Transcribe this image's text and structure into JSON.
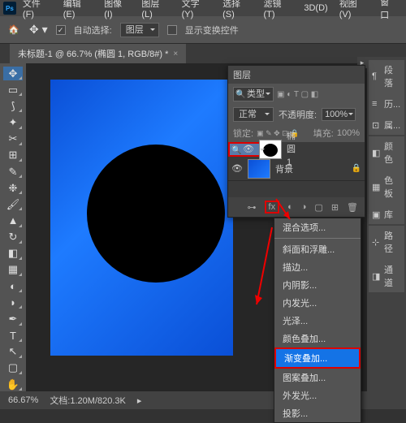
{
  "menu": {
    "items": [
      "文件(F)",
      "编辑(E)",
      "图像(I)",
      "图层(L)",
      "文字(Y)",
      "选择(S)",
      "滤镜(T)",
      "3D(D)",
      "视图(V)",
      "窗口"
    ]
  },
  "optbar": {
    "auto_select": "自动选择:",
    "layer": "图层",
    "show_transform": "显示变换控件"
  },
  "tab": {
    "title": "未标题-1 @ 66.7% (椭圆 1, RGB/8#) *"
  },
  "right": {
    "duanluo": "段落",
    "lishi": "历...",
    "shuxing": "属...",
    "yanse": "颜色",
    "secai": "色板",
    "kuang": "库",
    "lujing": "路径",
    "tongdao": "通道"
  },
  "layers": {
    "title": "图层",
    "type": "类型",
    "blend": "正常",
    "opacity_label": "不透明度:",
    "opacity": "100%",
    "lock_label": "锁定:",
    "fill_label": "填充:",
    "fill": "100%",
    "ellipse": "椭圆 1",
    "bg": "背景"
  },
  "fx": {
    "blend_options": "混合选项...",
    "bevel": "斜面和浮雕...",
    "stroke": "描边...",
    "inner_shadow": "内阴影...",
    "inner_glow": "内发光...",
    "satin": "光泽...",
    "color_overlay": "颜色叠加...",
    "gradient_overlay": "渐变叠加...",
    "pattern_overlay": "图案叠加...",
    "outer_glow": "外发光...",
    "drop_shadow": "投影..."
  },
  "status": {
    "zoom": "66.67%",
    "doc": "文档:1.20M/820.3K"
  }
}
